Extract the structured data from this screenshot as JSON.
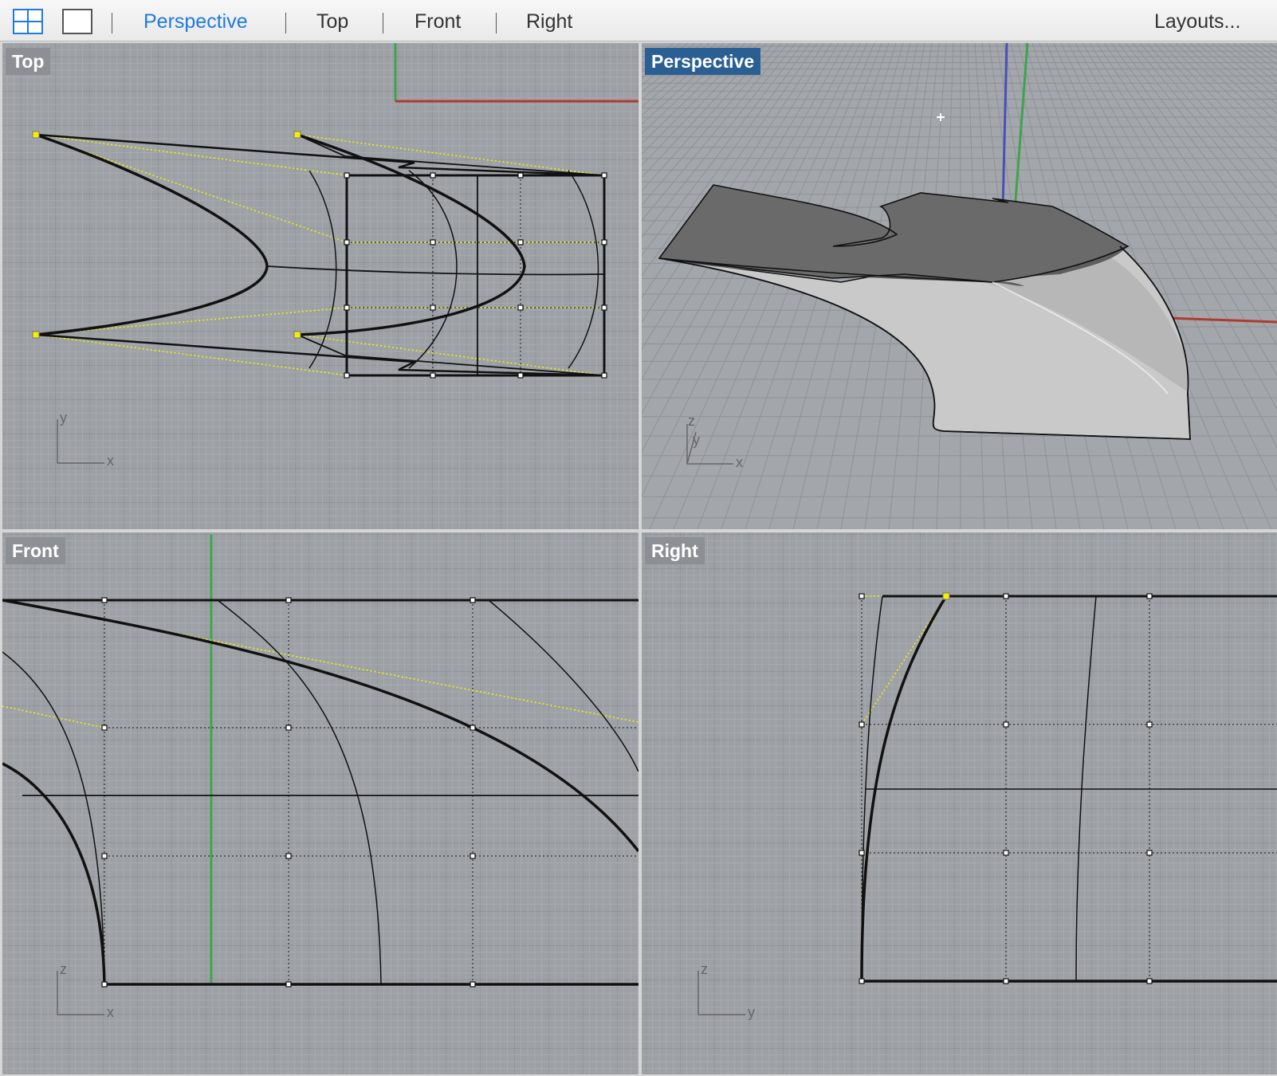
{
  "toolbar": {
    "icons": [
      "four-viewport-layout-icon",
      "single-viewport-layout-icon"
    ],
    "tabs": [
      {
        "label": "Perspective",
        "active": true
      },
      {
        "label": "Top",
        "active": false
      },
      {
        "label": "Front",
        "active": false
      },
      {
        "label": "Right",
        "active": false
      }
    ],
    "layouts_label": "Layouts..."
  },
  "viewports": {
    "top": {
      "title": "Top",
      "axis_h": "x",
      "axis_v": "y"
    },
    "perspective": {
      "title": "Perspective",
      "axis_h": "x",
      "axis_v": "z",
      "axis_d": "y"
    },
    "front": {
      "title": "Front",
      "axis_h": "x",
      "axis_v": "z"
    },
    "right": {
      "title": "Right",
      "axis_h": "y",
      "axis_v": "z"
    }
  },
  "colors": {
    "viewport_bg": "#9da1a6",
    "grid_minor": "#a8acb1",
    "grid_major": "#8c9095",
    "x_axis": "#b03a32",
    "y_axis": "#3fa34d",
    "z_axis": "#4a4fb8",
    "active_tab": "#1f7ae0",
    "active_title_bg": "#2a5f94",
    "selected_point": "#f5f000"
  }
}
